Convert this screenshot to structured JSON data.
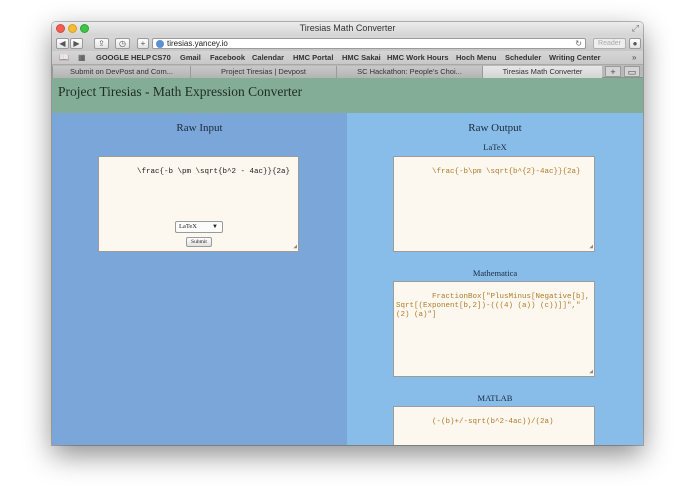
{
  "window": {
    "title": "Tiresias Math Converter"
  },
  "toolbar": {
    "url": "tiresias.yancey.io",
    "reader_label": "Reader"
  },
  "bookmarks": [
    "GOOGLE HELP",
    "CS70",
    "Gmail",
    "Facebook",
    "Calendar",
    "HMC Portal",
    "HMC Sakai",
    "HMC Work Hours",
    "Hoch Menu",
    "Scheduler",
    "Writing Center"
  ],
  "tabs": [
    {
      "label": "Submit on DevPost and Com...",
      "active": false
    },
    {
      "label": "Project Tiresias | Devpost",
      "active": false
    },
    {
      "label": "SC Hackathon: People's Choi...",
      "active": false
    },
    {
      "label": "Tiresias Math Converter",
      "active": true
    }
  ],
  "page": {
    "title": "Project Tiresias - Math Expression Converter",
    "raw_input": {
      "heading": "Raw Input",
      "value": "\\frac{-b \\pm \\sqrt{b^2 - 4ac}}{2a}",
      "format_selected": "LaTeX",
      "submit_label": "Submit"
    },
    "raw_output": {
      "heading": "Raw Output",
      "latex_label": "LaTeX",
      "latex_value": "\\frac{-b\\pm \\sqrt{b^{2}-4ac}}{2a}",
      "mathematica_label": "Mathematica",
      "mathematica_value": "FractionBox[\"PlusMinus[Negative[b],Sqrt[(Exponent[b,2])-(((4) (a)) (c))]]\",\"(2) (a)\"]",
      "matlab_label": "MATLAB",
      "matlab_value": "(-(b)+/-sqrt(b^2-4ac))/(2a)"
    }
  },
  "colors": {
    "header_bg": "#84ad97",
    "left_panel_bg": "#7ba6da",
    "right_panel_bg": "#88bdea",
    "output_text": "#b07c27"
  }
}
